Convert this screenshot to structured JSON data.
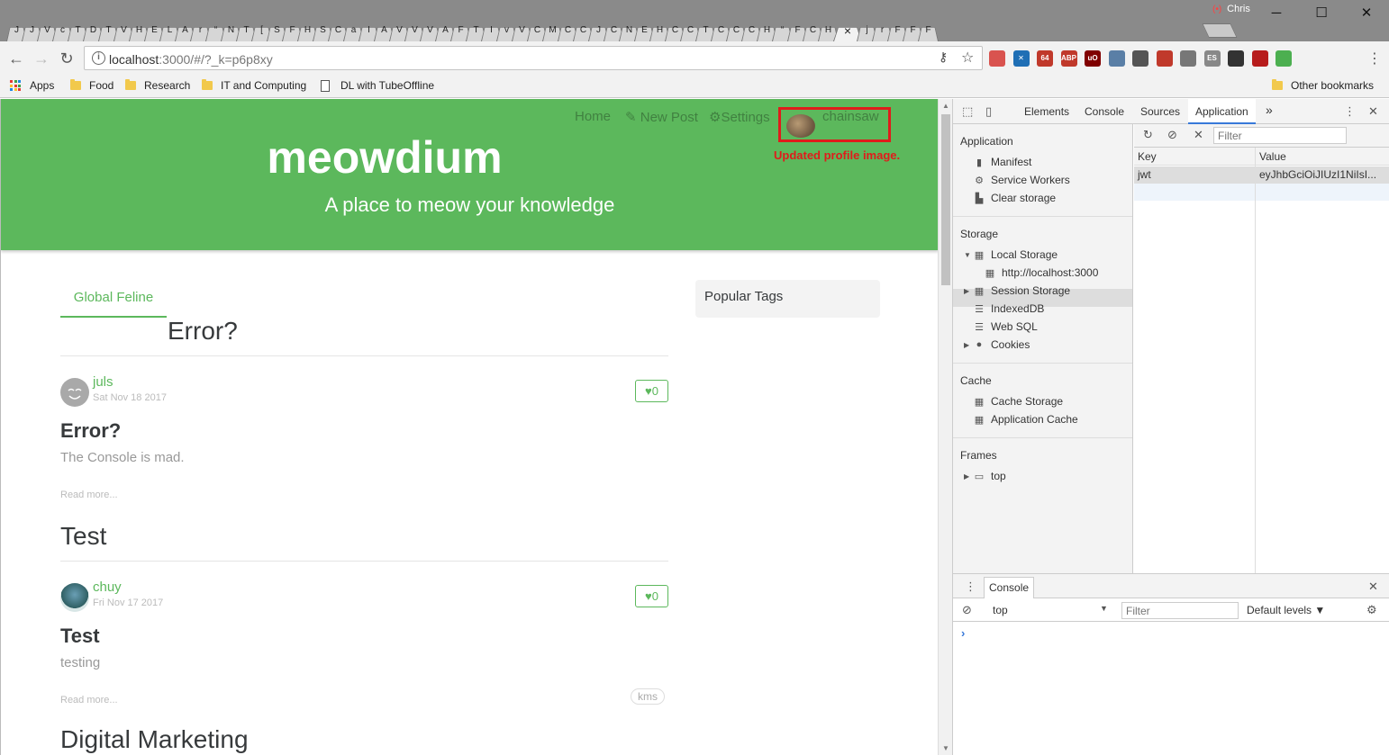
{
  "browser": {
    "tab_letters": [
      "J",
      "J",
      "V",
      "c",
      "T",
      "D",
      "T",
      "V",
      "H",
      "E",
      "L",
      "A",
      "r",
      "“",
      "N",
      "T",
      "[",
      "S",
      "F",
      "H",
      "S",
      "C",
      "a",
      "I",
      "A",
      "V",
      "V",
      "V",
      "A",
      "F",
      "T",
      "I",
      "v",
      "V",
      "C",
      "M",
      "C",
      "C",
      "J",
      "C",
      "N",
      "E",
      "H",
      "C",
      "C",
      "T",
      "C",
      "C",
      "C",
      "H",
      "“",
      "F",
      "C",
      "H"
    ],
    "active_tab_glyph": "×",
    "tabs_after": [
      "j",
      "r",
      "F",
      "F",
      "F"
    ],
    "user_name": "Chris",
    "url_prefix": "localhost",
    "url_rest": ":3000/#/?_k=p6p8xy",
    "bookmarks": [
      {
        "label": "Apps"
      },
      {
        "label": "Food"
      },
      {
        "label": "Research"
      },
      {
        "label": "IT and Computing"
      },
      {
        "label": "DL with TubeOffline"
      }
    ],
    "other_bookmarks": "Other bookmarks",
    "extensions": [
      {
        "label": "",
        "color": "#d9534f"
      },
      {
        "label": "✕",
        "color": "#1f6fb5"
      },
      {
        "label": "64",
        "color": "#c0392b"
      },
      {
        "label": "ABP",
        "color": "#c0392b"
      },
      {
        "label": "uO",
        "color": "#800000"
      },
      {
        "label": "",
        "color": "#5a7fa6"
      },
      {
        "label": "",
        "color": "#555555"
      },
      {
        "label": "",
        "color": "#c0392b"
      },
      {
        "label": "",
        "color": "#777777"
      },
      {
        "label": "ES",
        "color": "#888888"
      },
      {
        "label": "",
        "color": "#333333"
      },
      {
        "label": "",
        "color": "#b71c1c"
      },
      {
        "label": "",
        "color": "#4caf50"
      }
    ]
  },
  "site": {
    "nav": {
      "home": "Home",
      "new_post": "New Post",
      "settings": "Settings",
      "username": "chainsaw"
    },
    "annotation": "Updated profile image.",
    "brand": "meowdium",
    "tagline": "A place to meow your knowledge",
    "feed_tab": "Global Feline",
    "feed_heading": "Error?",
    "popular_tags": "Popular Tags",
    "articles": [
      {
        "author": "juls",
        "date": "Sat Nov 18 2017",
        "likes": "0",
        "title": "Error?",
        "description": "The Console is mad.",
        "read_more": "Read more..."
      },
      {
        "author": "chuy",
        "date": "Fri Nov 17 2017",
        "likes": "0",
        "title": "Test",
        "description": "testing",
        "read_more": "Read more...",
        "tag": "kms"
      }
    ],
    "section_heads": [
      "Test",
      "Digital Marketing"
    ],
    "accent_color": "#5cb85c"
  },
  "devtools": {
    "tabs": [
      "Elements",
      "Console",
      "Sources",
      "Application"
    ],
    "more": "»",
    "sidebar": {
      "application_header": "Application",
      "application_items": [
        "Manifest",
        "Service Workers",
        "Clear storage"
      ],
      "storage_header": "Storage",
      "storage_items": [
        "Local Storage",
        "http://localhost:3000",
        "Session Storage",
        "IndexedDB",
        "Web SQL",
        "Cookies"
      ],
      "cache_header": "Cache",
      "cache_items": [
        "Cache Storage",
        "Application Cache"
      ],
      "frames_header": "Frames",
      "frames_items": [
        "top"
      ]
    },
    "storage_filter_placeholder": "Filter",
    "table": {
      "key_header": "Key",
      "value_header": "Value",
      "rows": [
        {
          "key": "jwt",
          "value": "eyJhbGciOiJIUzI1NiIsI..."
        }
      ]
    },
    "console": {
      "tab": "Console",
      "context": "top",
      "filter_placeholder": "Filter",
      "levels": "Default levels",
      "prompt": "›"
    }
  }
}
